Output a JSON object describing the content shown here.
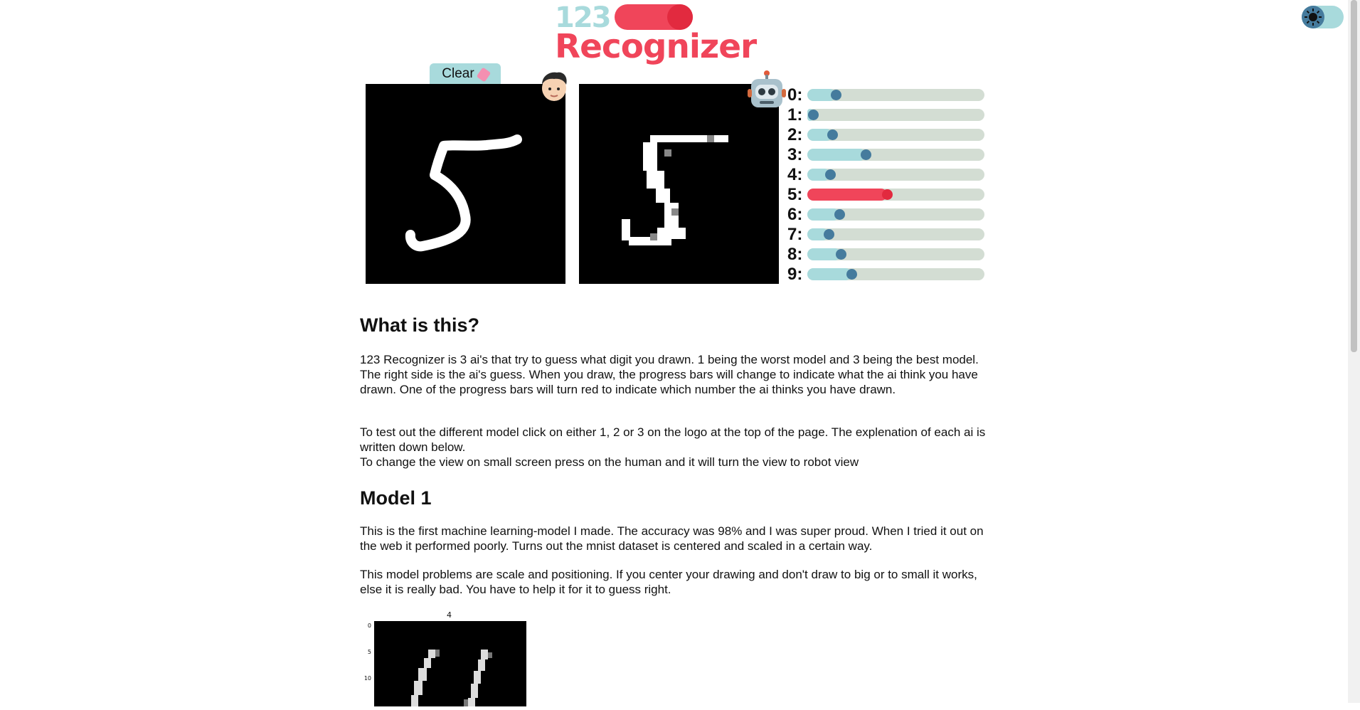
{
  "logo": {
    "digits": [
      "1",
      "2",
      "3"
    ],
    "word": "Recognizer"
  },
  "theme_toggle": {
    "icon": "sun-icon",
    "state": "dark"
  },
  "controls": {
    "clear_label": "Clear"
  },
  "avatars": {
    "human": "human-face-icon",
    "robot": "robot-face-icon"
  },
  "predictions": {
    "best_digit": 5,
    "items": [
      {
        "label": "0:",
        "value": 0.16
      },
      {
        "label": "1:",
        "value": 0.03
      },
      {
        "label": "2:",
        "value": 0.14
      },
      {
        "label": "3:",
        "value": 0.33
      },
      {
        "label": "4:",
        "value": 0.13
      },
      {
        "label": "5:",
        "value": 0.45
      },
      {
        "label": "6:",
        "value": 0.18
      },
      {
        "label": "7:",
        "value": 0.12
      },
      {
        "label": "8:",
        "value": 0.19
      },
      {
        "label": "9:",
        "value": 0.25
      }
    ]
  },
  "article": {
    "heading_what": "What is this?",
    "para1": "123 Recognizer is 3 ai's that try to guess what digit you drawn. 1 being the worst model and 3 being the best model. The right side is the ai's guess. When you draw, the progress bars will change to indicate what the ai think you have drawn. One of the progress bars will turn red to indicate which number the ai thinks you have drawn.",
    "para2_line1": "To test out the different model click on either 1, 2 or 3 on the logo at the top of the page. The explenation of each ai is written down below.",
    "para2_line2": "To change the view on small screen press on the human and it will turn the view to robot view",
    "heading_model1": "Model 1",
    "para3": "This is the first machine learning-model I made. The accuracy was 98% and I was super proud. When I tried it out on the web it performed poorly. Turns out the mnist dataset is centered and scaled in a certain way.",
    "para4": "This model problems are scale and positioning. If you center your drawing and don't draw to big or to small it works, else it is really bad. You have to help it for it to guess right."
  },
  "figure": {
    "title": "4",
    "yticks": [
      "0",
      "5",
      "10"
    ]
  },
  "colors": {
    "accent_red": "#f0455a",
    "accent_teal": "#a8dadc",
    "knob_blue": "#457b9d",
    "track_gray": "#d3ddd3"
  }
}
